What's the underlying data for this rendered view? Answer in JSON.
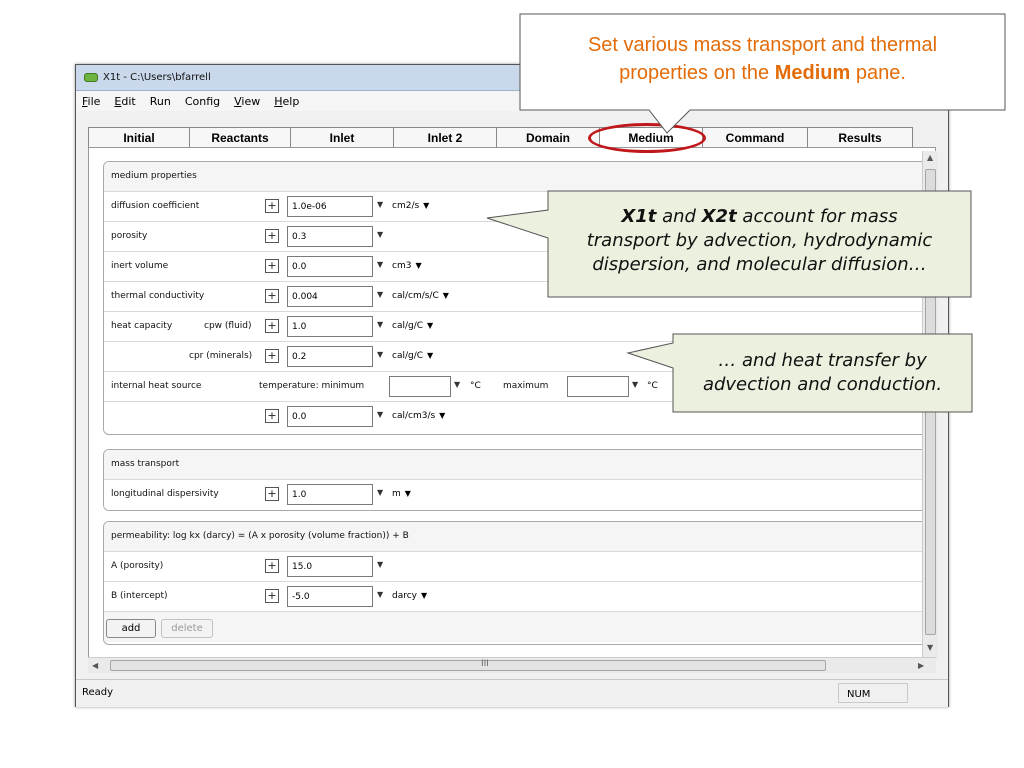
{
  "window": {
    "title": "X1t - C:\\Users\\bfarrell",
    "menu": [
      {
        "key": "F",
        "rest": "ile"
      },
      {
        "key": "E",
        "rest": "dit"
      },
      {
        "key": "",
        "rest": "Run"
      },
      {
        "key": "",
        "rest": "Config"
      },
      {
        "key": "V",
        "rest": "iew"
      },
      {
        "key": "H",
        "rest": "elp"
      }
    ],
    "tabs": [
      "Initial",
      "Reactants",
      "Inlet",
      "Inlet 2",
      "Domain",
      "Medium",
      "Command",
      "Results"
    ],
    "active_tab": "Medium",
    "status": {
      "left": "Ready",
      "right": "NUM"
    },
    "scroll_grip": "III"
  },
  "medium_panel": {
    "header": "medium properties",
    "diffusion": {
      "label": "diffusion coefficient",
      "value": "1.0e-06",
      "unit": "cm2/s"
    },
    "porosity": {
      "label": "porosity",
      "value": "0.3"
    },
    "inert_volume": {
      "label": "inert volume",
      "value": "0.0",
      "unit": "cm3"
    },
    "thermal_conductivity": {
      "label": "thermal conductivity",
      "value": "0.004",
      "unit": "cal/cm/s/C"
    },
    "heat_capacity": {
      "label": "heat capacity",
      "fluid_label": "cpw (fluid)",
      "fluid_value": "1.0",
      "fluid_unit": "cal/g/C",
      "minerals_label": "cpr (minerals)",
      "minerals_value": "0.2",
      "minerals_unit": "cal/g/C"
    },
    "heat_source": {
      "label": "internal heat source",
      "temp_label": "temperature: minimum",
      "min_unit": "°C",
      "max_label": "maximum",
      "max_unit": "°C",
      "value": "0.0",
      "unit": "cal/cm3/s"
    }
  },
  "mass_panel": {
    "header": "mass transport",
    "dispersivity": {
      "label": "longitudinal dispersivity",
      "value": "1.0",
      "unit": "m"
    }
  },
  "perm_panel": {
    "header": "permeability: log kx (darcy) = (A x porosity (volume fraction)) + B",
    "a": {
      "label": "A (porosity)",
      "value": "15.0"
    },
    "b": {
      "label": "B (intercept)",
      "value": "-5.0",
      "unit": "darcy"
    }
  },
  "buttons": {
    "add": "add",
    "delete": "delete"
  },
  "callouts": {
    "top_line1": "Set various mass  transport and thermal",
    "top_line2_pre": "properties on the ",
    "top_line2_bold": "Medium",
    "top_line2_post": " pane.",
    "mid_x1t": "X1t",
    "mid_and": " and ",
    "mid_x2t": "X2t",
    "mid_line1_post": " account for mass",
    "mid_line2": "transport by advection, hydrodynamic",
    "mid_line3": "dispersion, and molecular diffusion…",
    "low_line1": "… and heat transfer by",
    "low_line2": "advection and conduction.",
    "colors": {
      "top_text": "#e36c09",
      "callout_fill": "#ebf1de",
      "highlight_ring": "#c0171b"
    }
  }
}
